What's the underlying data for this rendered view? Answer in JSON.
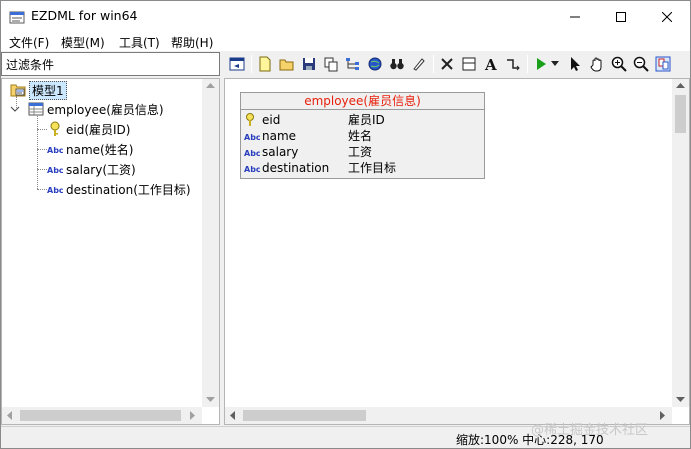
{
  "window": {
    "title": "EZDML for win64"
  },
  "menu": [
    {
      "label": "文件(F)"
    },
    {
      "label": "模型(M)"
    },
    {
      "label": "工具(T)"
    },
    {
      "label": "帮助(H)"
    }
  ],
  "filter": {
    "label": "过滤条件"
  },
  "tree": {
    "root": "模型1",
    "table": "employee(雇员信息)",
    "fields": [
      {
        "label": "eid(雇员ID)",
        "icon": "key-icon"
      },
      {
        "label": "name(姓名)",
        "icon": "abc-icon"
      },
      {
        "label": "salary(工资)",
        "icon": "abc-icon"
      },
      {
        "label": "destination(工作目标)",
        "icon": "abc-icon"
      }
    ]
  },
  "entity": {
    "title": "employee(雇员信息)",
    "fields": [
      {
        "name": "eid",
        "cn": "雇员ID",
        "icon": "key-icon"
      },
      {
        "name": "name",
        "cn": "姓名",
        "icon": "abc-icon"
      },
      {
        "name": "salary",
        "cn": "工资",
        "icon": "abc-icon"
      },
      {
        "name": "destination",
        "cn": "工作目标",
        "icon": "abc-icon"
      }
    ]
  },
  "status": {
    "text": "缩放:100% 中心:228, 170"
  },
  "watermark": "@稀土掘金技术社区",
  "colors": {
    "entity_title": "#e8200c",
    "selection": "#cce8ff"
  }
}
